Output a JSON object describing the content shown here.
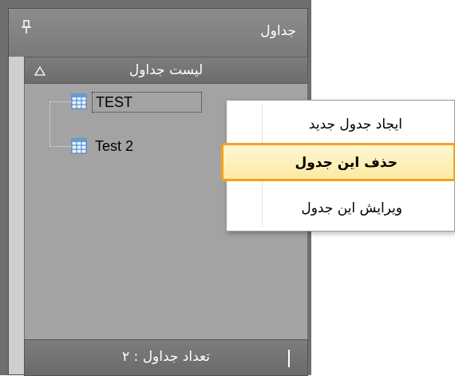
{
  "panel": {
    "title": "جداول",
    "section_title": "لیست جداول",
    "footer_label": "تعداد جداول : ۲"
  },
  "tree": {
    "items": [
      {
        "label": "TEST",
        "selected": true
      },
      {
        "label": "Test 2",
        "selected": false
      }
    ]
  },
  "context_menu": {
    "items": [
      {
        "label": "ایجاد جدول جدید"
      },
      {
        "label": "حذف این جدول",
        "highlighted": true
      },
      {
        "label": "ویرایش این جدول"
      }
    ]
  },
  "colors": {
    "highlight_border": "#f0a21e",
    "highlight_fill": "#fde9a2",
    "panel_header": "#7a7a7a",
    "tree_background": "#a3a3a3"
  },
  "icons": {
    "pin": "pin-icon",
    "collapse": "collapse-up-icon",
    "table": "table-icon"
  }
}
